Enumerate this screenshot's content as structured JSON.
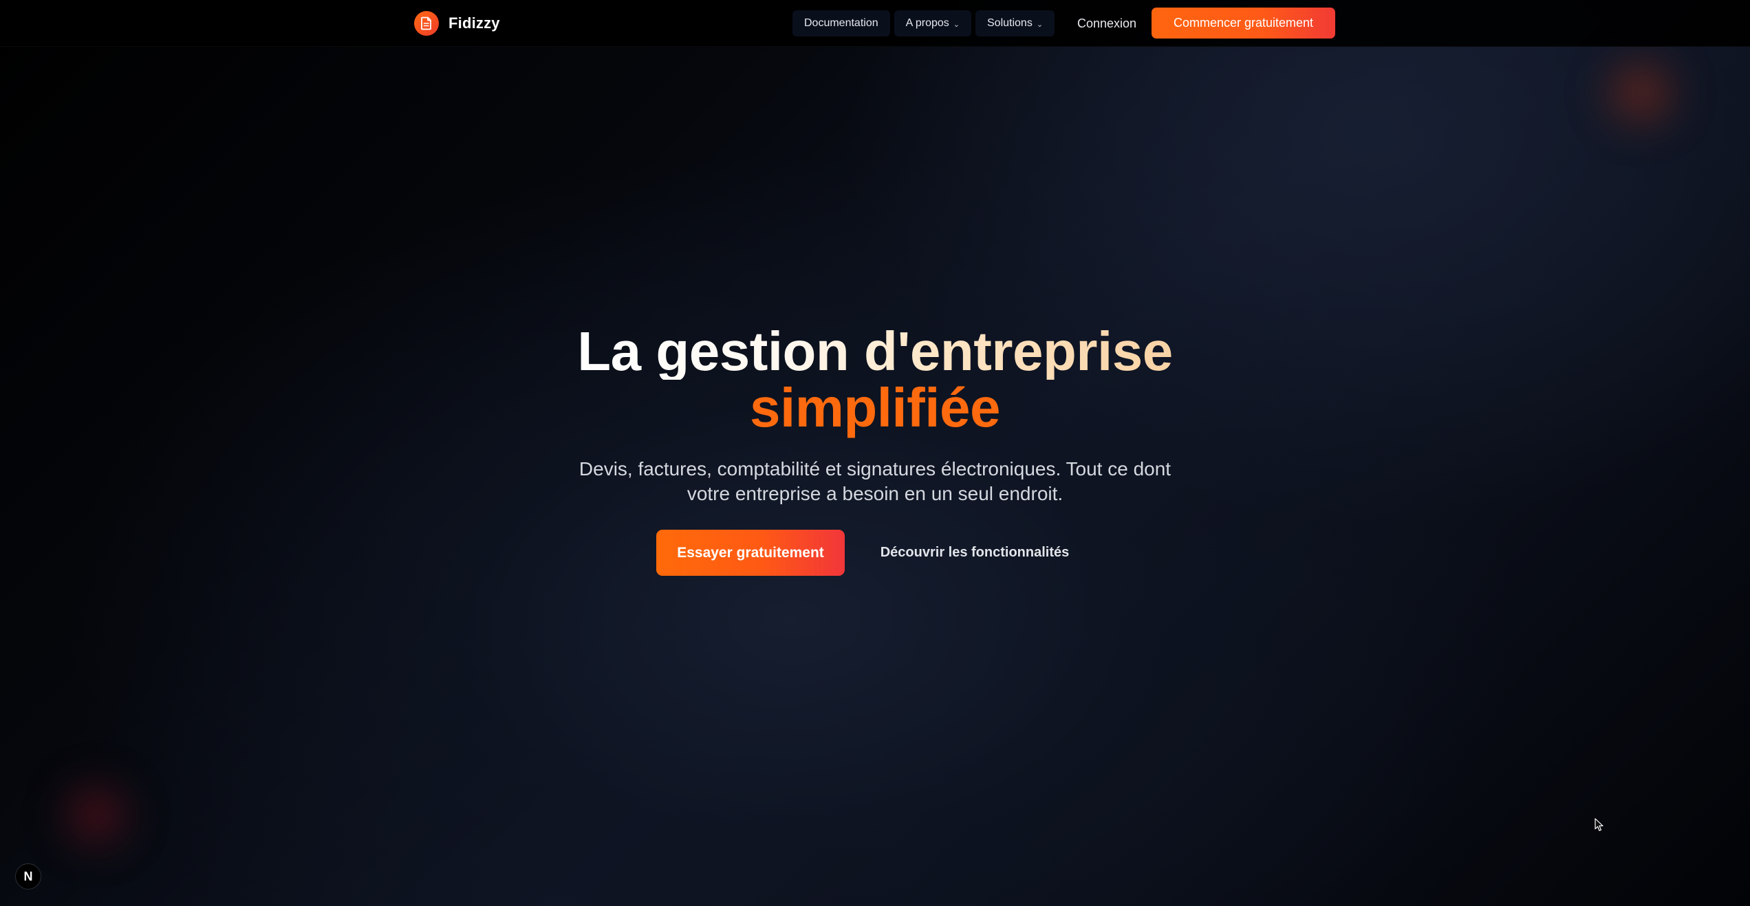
{
  "brand": {
    "name": "Fidizzy",
    "icon": "document-icon",
    "color": "#ff6a13"
  },
  "nav": {
    "links": [
      {
        "label": "Documentation",
        "has_dropdown": false
      },
      {
        "label": "A propos",
        "has_dropdown": true
      },
      {
        "label": "Solutions",
        "has_dropdown": true
      }
    ],
    "login_label": "Connexion",
    "cta_label": "Commencer gratuitement",
    "chevron": "⌄"
  },
  "hero": {
    "title_line1": "La gestion d'entreprise",
    "title_line2": "simplifiée",
    "subtitle": "Devis, factures, comptabilité et signatures électroniques. Tout ce dont votre entreprise a besoin en un seul endroit.",
    "primary_button": "Essayer gratuitement",
    "secondary_button": "Découvrir les fonctionnalités"
  },
  "dev_badge": {
    "label": "N",
    "icon": "nextjs-icon"
  },
  "colors": {
    "accent": "#ff6a0f",
    "accent_end": "#f2363a",
    "background": "#000000"
  }
}
